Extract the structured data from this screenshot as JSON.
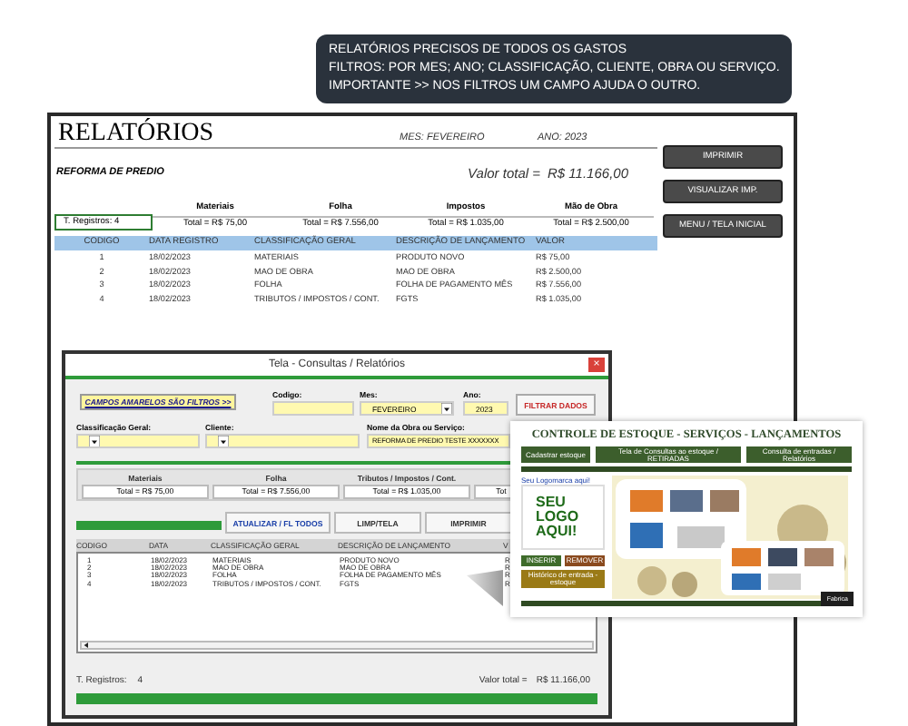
{
  "banner": {
    "lines": [
      "RELATÓRIOS PRECISOS DE TODOS OS GASTOS",
      "FILTROS: POR MES; ANO; CLASSIFICAÇÃO, CLIENTE, OBRA OU SERVIÇO.",
      "IMPORTANTE >> NOS FILTROS UM CAMPO AJUDA O OUTRO."
    ]
  },
  "report": {
    "title": "RELATÓRIOS",
    "month": "MES: FEVEREIRO",
    "year": "ANO: 2023",
    "work": "REFORMA DE PREDIO",
    "total_label": "Valor total =",
    "total_value": "R$ 11.166,00",
    "records": "T. Registros: 4",
    "summary": [
      {
        "label": "Materiais",
        "total": "Total =  R$ 75,00"
      },
      {
        "label": "Folha",
        "total": "Total =  R$ 7.556,00"
      },
      {
        "label": "Impostos",
        "total": "Total =  R$ 1.035,00"
      },
      {
        "label": "Mão de Obra",
        "total": "Total =  R$ 2.500,00"
      }
    ],
    "columns": [
      "CODIGO",
      "DATA REGISTRO",
      "CLASSIFICAÇÃO GERAL",
      "DESCRIÇÃO DE LANÇAMENTO",
      "VALOR"
    ],
    "rows": [
      [
        "1",
        "18/02/2023",
        "MATERIAIS",
        "PRODUTO NOVO",
        "R$ 75,00"
      ],
      [
        "2",
        "18/02/2023",
        "MAO DE OBRA",
        "MAO DE OBRA",
        "R$ 2.500,00"
      ],
      [
        "3",
        "18/02/2023",
        "FOLHA",
        "FOLHA DE PAGAMENTO MÊS",
        "R$ 7.556,00"
      ],
      [
        "4",
        "18/02/2023",
        "TRIBUTOS / IMPOSTOS / CONT.",
        "FGTS",
        "R$ 1.035,00"
      ]
    ],
    "buttons": [
      "IMPRIMIR",
      "VISUALIZAR IMP.",
      "MENU / TELA INICIAL"
    ]
  },
  "query_window": {
    "title": "Tela - Consultas / Relatórios",
    "close": "×",
    "filter_hint": "CAMPOS AMARELOS SÃO FILTROS >>",
    "filters_top": [
      {
        "label": "Codigo:",
        "dropdown": false
      },
      {
        "label": "Mes:",
        "value": "FEVEREIRO",
        "dropdown": true
      },
      {
        "label": "Ano:",
        "value": "2023",
        "dropdown": false
      }
    ],
    "filter_button": "FILTRAR DADOS",
    "filters_bottom": [
      {
        "label": "Classificação Geral:",
        "dropdown": true
      },
      {
        "label": "Cliente:",
        "dropdown": true
      },
      {
        "label": "Nome da Obra ou Serviço:",
        "value": "REFORMA DE PREDIO TESTE XXXXXXX",
        "dropdown": false
      }
    ],
    "summary": [
      {
        "label": "Materiais",
        "total": "Total =  R$ 75,00"
      },
      {
        "label": "Folha",
        "total": "Total =  R$ 7.556,00"
      },
      {
        "label": "Tributos / Impostos / Cont.",
        "total": "Total =  R$ 1.035,00"
      },
      {
        "total": "Tot"
      }
    ],
    "actions": [
      "ATUALIZAR / FL TODOS",
      "LIMP/TELA",
      "IMPRIMIR"
    ],
    "columns": [
      "CODIGO",
      "DATA",
      "CLASSIFICAÇÃO GERAL",
      "DESCRIÇÃO DE LANÇAMENTO",
      "V"
    ],
    "rows": [
      [
        "1",
        "18/02/2023",
        "MATERIAIS",
        "PRODUTO NOVO",
        "R"
      ],
      [
        "2",
        "18/02/2023",
        "MAO DE OBRA",
        "MAO DE OBRA",
        "R"
      ],
      [
        "3",
        "18/02/2023",
        "FOLHA",
        "FOLHA DE PAGAMENTO MÊS",
        "R"
      ],
      [
        "4",
        "18/02/2023",
        "TRIBUTOS / IMPOSTOS / CONT.",
        "FGTS",
        "R"
      ]
    ],
    "records_label": "T. Registros:",
    "records_count": "4",
    "total_label": "Valor total =",
    "total_value": "R$ 11.166,00"
  },
  "app_preview": {
    "title": "CONTROLE DE ESTOQUE - SERVIÇOS - LANÇAMENTOS",
    "nav": [
      "Cadastrar estoque",
      "Tela de Consultas ao estoque / RETIRADAS",
      "Consulta de entradas / Relatórios"
    ],
    "logo_hint": "Seu Logomarca aqui!",
    "logo_text": "SEU LOGO AQUI!",
    "buttons": [
      {
        "label": "INSERIR",
        "color": "#3e6b2a"
      },
      {
        "label": "REMOVER",
        "color": "#8a4a1e"
      }
    ],
    "history_button": "Histórico de entrada - estoque",
    "corner_label": "Fabrica"
  }
}
